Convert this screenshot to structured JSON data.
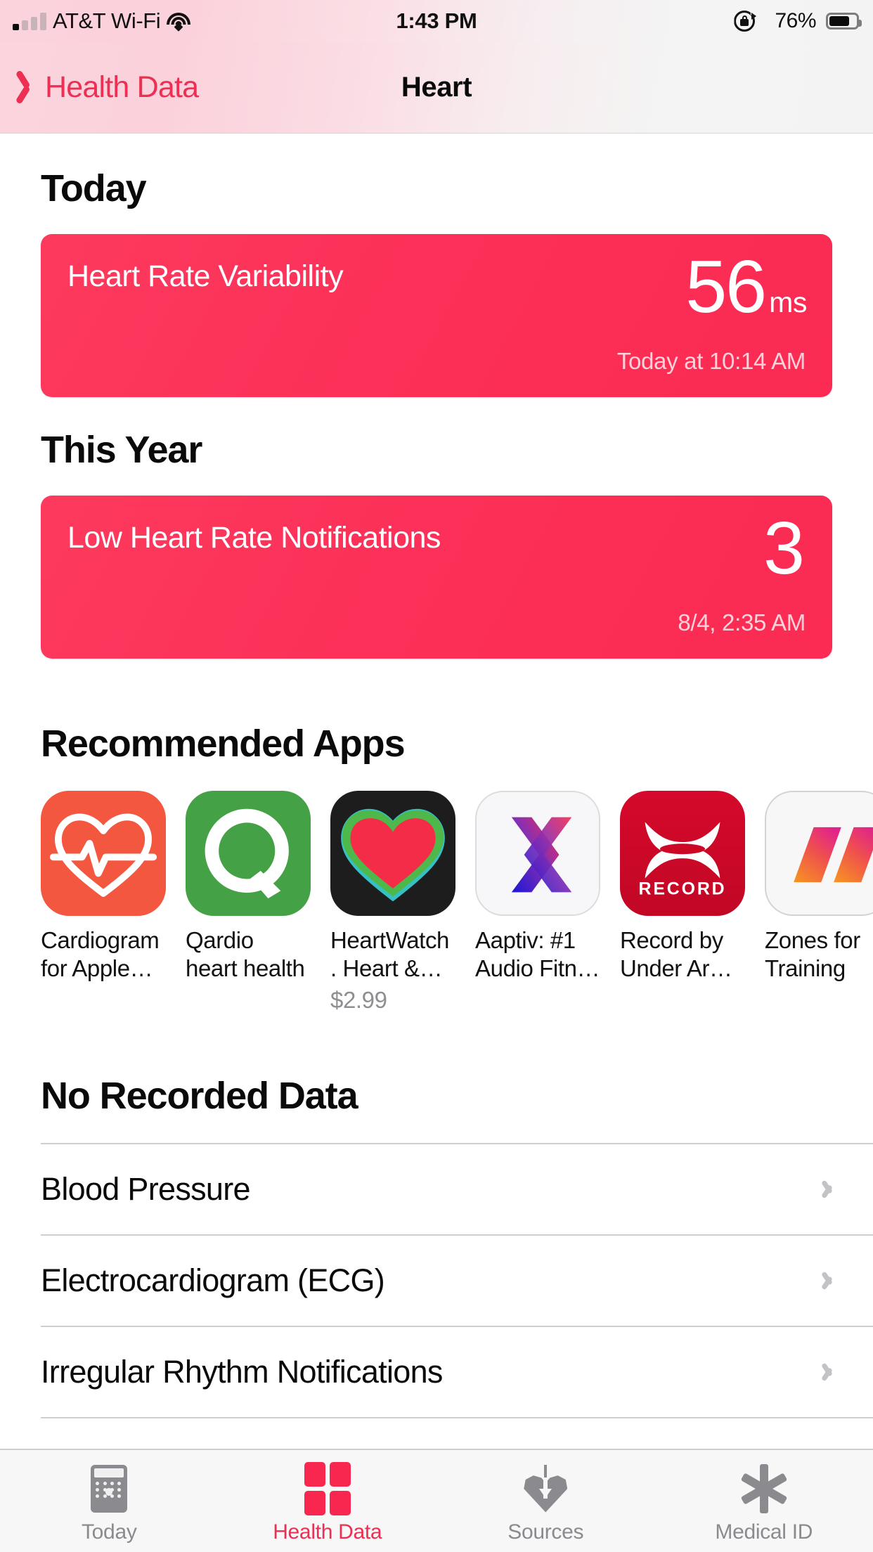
{
  "statusbar": {
    "carrier": "AT&T Wi-Fi",
    "time": "1:43 PM",
    "battery_percent": "76%",
    "signal_icon": "cellular-bars-icon",
    "wifi_icon": "wifi-icon",
    "rotation_lock_icon": "rotation-lock-icon",
    "location_icon": "location-arrow-icon",
    "battery_icon": "battery-icon"
  },
  "navbar": {
    "back_label": "Health Data",
    "back_icon": "chevron-left-icon",
    "title": "Heart"
  },
  "sections": {
    "today": {
      "heading": "Today",
      "card": {
        "title": "Heart Rate Variability",
        "value": "56",
        "unit": "ms",
        "timestamp": "Today at 10:14 AM"
      }
    },
    "this_year": {
      "heading": "This Year",
      "card": {
        "title": "Low Heart Rate Notifications",
        "value": "3",
        "unit": "",
        "timestamp": "8/4, 2:35 AM"
      }
    },
    "recommended": {
      "heading": "Recommended Apps",
      "apps": [
        {
          "name": "Cardiogram\nfor Apple…",
          "price": "",
          "icon": "cardiogram-app-icon"
        },
        {
          "name": "Qardio\nheart health",
          "price": "",
          "icon": "qardio-app-icon"
        },
        {
          "name": "HeartWatch\n. Heart &…",
          "price": "$2.99",
          "icon": "heartwatch-app-icon"
        },
        {
          "name": "Aaptiv: #1\nAudio Fitn…",
          "price": "",
          "icon": "aaptiv-app-icon"
        },
        {
          "name": "Record by\nUnder Ar…",
          "price": "",
          "icon": "record-under-armour-app-icon"
        },
        {
          "name": "Zones for\nTraining",
          "price": "",
          "icon": "zones-for-training-app-icon"
        }
      ]
    },
    "no_recorded_data": {
      "heading": "No Recorded Data",
      "rows": [
        {
          "label": "Blood Pressure"
        },
        {
          "label": "Electrocardiogram (ECG)"
        },
        {
          "label": "Irregular Rhythm Notifications"
        }
      ]
    }
  },
  "tabbar": {
    "tabs": [
      {
        "label": "Today",
        "icon": "calendar-icon",
        "active": false
      },
      {
        "label": "Health Data",
        "icon": "health-data-grid-icon",
        "active": true
      },
      {
        "label": "Sources",
        "icon": "sources-heart-arrow-icon",
        "active": false
      },
      {
        "label": "Medical ID",
        "icon": "medical-id-asterisk-icon",
        "active": false
      }
    ]
  },
  "colors": {
    "accent_red": "#ec2f52",
    "card_red": "#fc3058",
    "tab_inactive": "#8b8b8f",
    "price_gray": "#8e8e93"
  }
}
